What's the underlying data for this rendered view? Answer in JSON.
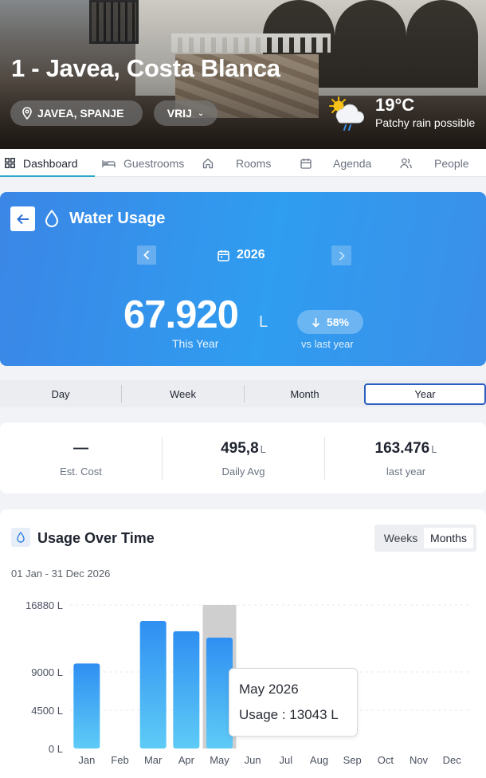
{
  "hero": {
    "title": "1 - Javea, Costa Blanca",
    "location": "JAVEA, SPANJE",
    "status": "VRIJ",
    "temperature": "19°C",
    "condition": "Patchy rain possible"
  },
  "tabs": [
    {
      "label": "Dashboard",
      "icon": "dashboard-icon",
      "active": true
    },
    {
      "label": "Guestrooms",
      "icon": "bed-icon"
    },
    {
      "label": "Rooms",
      "icon": "home-icon"
    },
    {
      "label": "Agenda",
      "icon": "calendar-icon"
    },
    {
      "label": "People",
      "icon": "people-icon"
    }
  ],
  "water": {
    "title": "Water Usage",
    "year": "2026",
    "total": "67.920",
    "unit": "L",
    "total_label": "This Year",
    "change": "58%",
    "change_label": "vs last year"
  },
  "periods": [
    "Day",
    "Week",
    "Month",
    "Year"
  ],
  "active_period": "Year",
  "stats": [
    {
      "value": "—",
      "unit": "",
      "label": "Est. Cost"
    },
    {
      "value": "495,8",
      "unit": "L",
      "label": "Daily Avg"
    },
    {
      "value": "163.476",
      "unit": "L",
      "label": "last year"
    }
  ],
  "chart_card": {
    "title": "Usage Over Time",
    "toggle": [
      "Weeks",
      "Months"
    ],
    "active_toggle": "Months",
    "range": "01 Jan - 31 Dec 2026"
  },
  "tooltip": {
    "title": "May 2026",
    "body": "Usage : 13043 L"
  },
  "chart_data": {
    "type": "bar",
    "categories": [
      "Jan",
      "Feb",
      "Mar",
      "Apr",
      "May",
      "Jun",
      "Jul",
      "Aug",
      "Sep",
      "Oct",
      "Nov",
      "Dec"
    ],
    "values": [
      10000,
      0,
      15000,
      13800,
      13043,
      0,
      0,
      0,
      0,
      0,
      0,
      0
    ],
    "ylim": [
      0,
      16880
    ],
    "yticks": [
      0,
      4500,
      9000,
      16880
    ],
    "ytick_labels": [
      "0 L",
      "4500 L",
      "9000 L",
      "16880 L"
    ],
    "highlight": "May",
    "bar_color_top": "#2f8ff2",
    "bar_color_bottom": "#5ecbf6",
    "highlight_color": "#cfcfcf"
  }
}
